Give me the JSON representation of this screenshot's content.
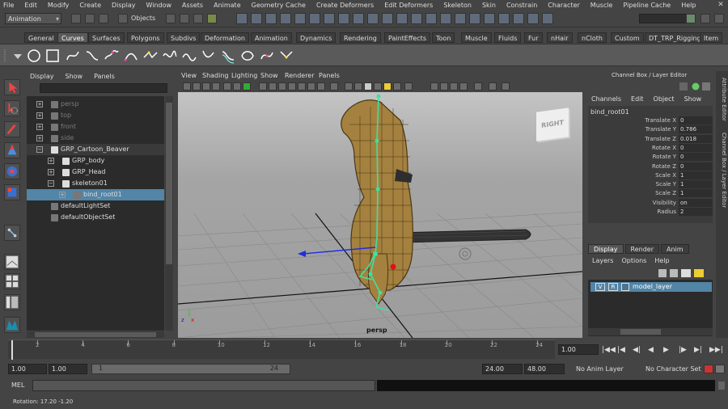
{
  "menubar": {
    "items": [
      "File",
      "Edit",
      "Modify",
      "Create",
      "Display",
      "Window",
      "Assets",
      "Animate",
      "Geometry Cache",
      "Create Deformers",
      "Edit Deformers",
      "Skeleton",
      "Skin",
      "Constrain",
      "Character",
      "Muscle",
      "Pipeline Cache",
      "Help"
    ]
  },
  "statusline": {
    "mode": "Animation",
    "objects_label": "Objects"
  },
  "shelf": {
    "tabs": [
      "General",
      "Curves",
      "Surfaces",
      "Polygons",
      "Subdivs",
      "Deformation",
      "Animation",
      "Dynamics",
      "Rendering",
      "PaintEffects",
      "Toon",
      "Muscle",
      "Fluids",
      "Fur",
      "nHair",
      "nCloth",
      "Custom",
      "DT_TRP_Rigging",
      "Item"
    ],
    "active": "Curves"
  },
  "outliner": {
    "menu": [
      "Display",
      "Show",
      "Panels"
    ],
    "items": [
      {
        "label": "persp",
        "indent": 0,
        "dim": true,
        "expander": "+",
        "icon": "camera-icon"
      },
      {
        "label": "top",
        "indent": 0,
        "dim": true,
        "expander": "+",
        "icon": "camera-icon"
      },
      {
        "label": "front",
        "indent": 0,
        "dim": true,
        "expander": "+",
        "icon": "camera-icon"
      },
      {
        "label": "side",
        "indent": 0,
        "dim": true,
        "expander": "+",
        "icon": "camera-icon"
      },
      {
        "label": "GRP_Cartoon_Beaver",
        "indent": 0,
        "dim": false,
        "expander": "−",
        "icon": "group-icon"
      },
      {
        "label": "GRP_body",
        "indent": 1,
        "dim": false,
        "expander": "+",
        "icon": "group-icon"
      },
      {
        "label": "GRP_Head",
        "indent": 1,
        "dim": false,
        "expander": "+",
        "icon": "group-icon"
      },
      {
        "label": "skeleton01",
        "indent": 1,
        "dim": false,
        "expander": "−",
        "icon": "group-icon"
      },
      {
        "label": "bind_root01",
        "indent": 2,
        "dim": false,
        "expander": "+",
        "icon": "joint-icon",
        "selected": true
      },
      {
        "label": "defaultLightSet",
        "indent": 0,
        "dim": false,
        "expander": "",
        "icon": "set-icon"
      },
      {
        "label": "defaultObjectSet",
        "indent": 0,
        "dim": false,
        "expander": "",
        "icon": "set-icon"
      }
    ]
  },
  "viewport": {
    "menu": [
      "View",
      "Shading",
      "Lighting",
      "Show",
      "Renderer",
      "Panels"
    ],
    "camera_label": "persp",
    "viewcube_label": "RIGHT",
    "axis_labels": {
      "z": "z",
      "x": "x"
    }
  },
  "channelbox": {
    "title": "Channel Box / Layer Editor",
    "menu": [
      "Channels",
      "Edit",
      "Object",
      "Show"
    ],
    "node": "bind_root01",
    "attributes": [
      {
        "label": "Translate X",
        "value": "0"
      },
      {
        "label": "Translate Y",
        "value": "0.786"
      },
      {
        "label": "Translate Z",
        "value": "0.018"
      },
      {
        "label": "Rotate X",
        "value": "0"
      },
      {
        "label": "Rotate Y",
        "value": "0"
      },
      {
        "label": "Rotate Z",
        "value": "0"
      },
      {
        "label": "Scale X",
        "value": "1"
      },
      {
        "label": "Scale Y",
        "value": "1"
      },
      {
        "label": "Scale Z",
        "value": "1"
      },
      {
        "label": "Visibility",
        "value": "on"
      },
      {
        "label": "Radius",
        "value": "2"
      }
    ],
    "tabs": [
      "Display",
      "Render",
      "Anim"
    ],
    "layer_menu": [
      "Layers",
      "Options",
      "Help"
    ],
    "layer": {
      "v": "V",
      "r": "R",
      "name": "model_layer"
    }
  },
  "sidetabs": [
    "Attribute Editor",
    "Channel Box / Layer Editor"
  ],
  "timeslider": {
    "ticks": [
      "2",
      "4",
      "6",
      "8",
      "10",
      "12",
      "14",
      "16",
      "18",
      "20",
      "22",
      "24"
    ],
    "current_frame": "1.00",
    "playback": [
      "|◀◀",
      "|◀",
      "◀|",
      "◀",
      "▶",
      "|▶",
      "▶|",
      "▶▶|"
    ]
  },
  "rangeslider": {
    "start": "1.00",
    "start2": "1.00",
    "bar_start": "1",
    "bar_end": "24",
    "end": "24.00",
    "end2": "48.00",
    "anim_layer": "No Anim Layer",
    "character_set": "No Character Set"
  },
  "cmdline": {
    "label": "MEL"
  },
  "helpline": {
    "text": "Rotation:   17.20     -1.20"
  },
  "colors": {
    "selection": "#5285a6",
    "bg": "#444444"
  }
}
